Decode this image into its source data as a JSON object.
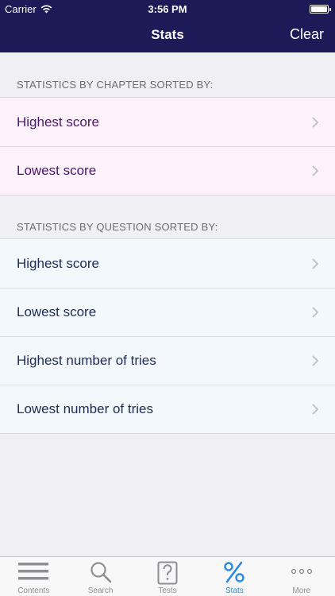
{
  "status_bar": {
    "carrier": "Carrier",
    "time": "3:56 PM"
  },
  "navbar": {
    "title": "Stats",
    "clear_label": "Clear"
  },
  "chapter_section": {
    "header": "STATISTICS BY CHAPTER SORTED BY:",
    "items": [
      {
        "label": "Highest score"
      },
      {
        "label": "Lowest score"
      }
    ]
  },
  "question_section": {
    "header": "STATISTICS BY QUESTION SORTED BY:",
    "items": [
      {
        "label": "Highest score"
      },
      {
        "label": "Lowest score"
      },
      {
        "label": "Highest number of tries"
      },
      {
        "label": "Lowest number of tries"
      }
    ]
  },
  "tabbar": {
    "items": [
      {
        "label": "Contents",
        "icon": "list-icon"
      },
      {
        "label": "Search",
        "icon": "search-icon"
      },
      {
        "label": "Tests",
        "icon": "question-card-icon"
      },
      {
        "label": "Stats",
        "icon": "percent-icon",
        "active": true
      },
      {
        "label": "More",
        "icon": "more-icon"
      }
    ]
  },
  "colors": {
    "navbar_bg": "#1c1a57",
    "chapter_text": "#4b1670",
    "question_text": "#1f2b55",
    "active_tab": "#2b8ae0"
  }
}
